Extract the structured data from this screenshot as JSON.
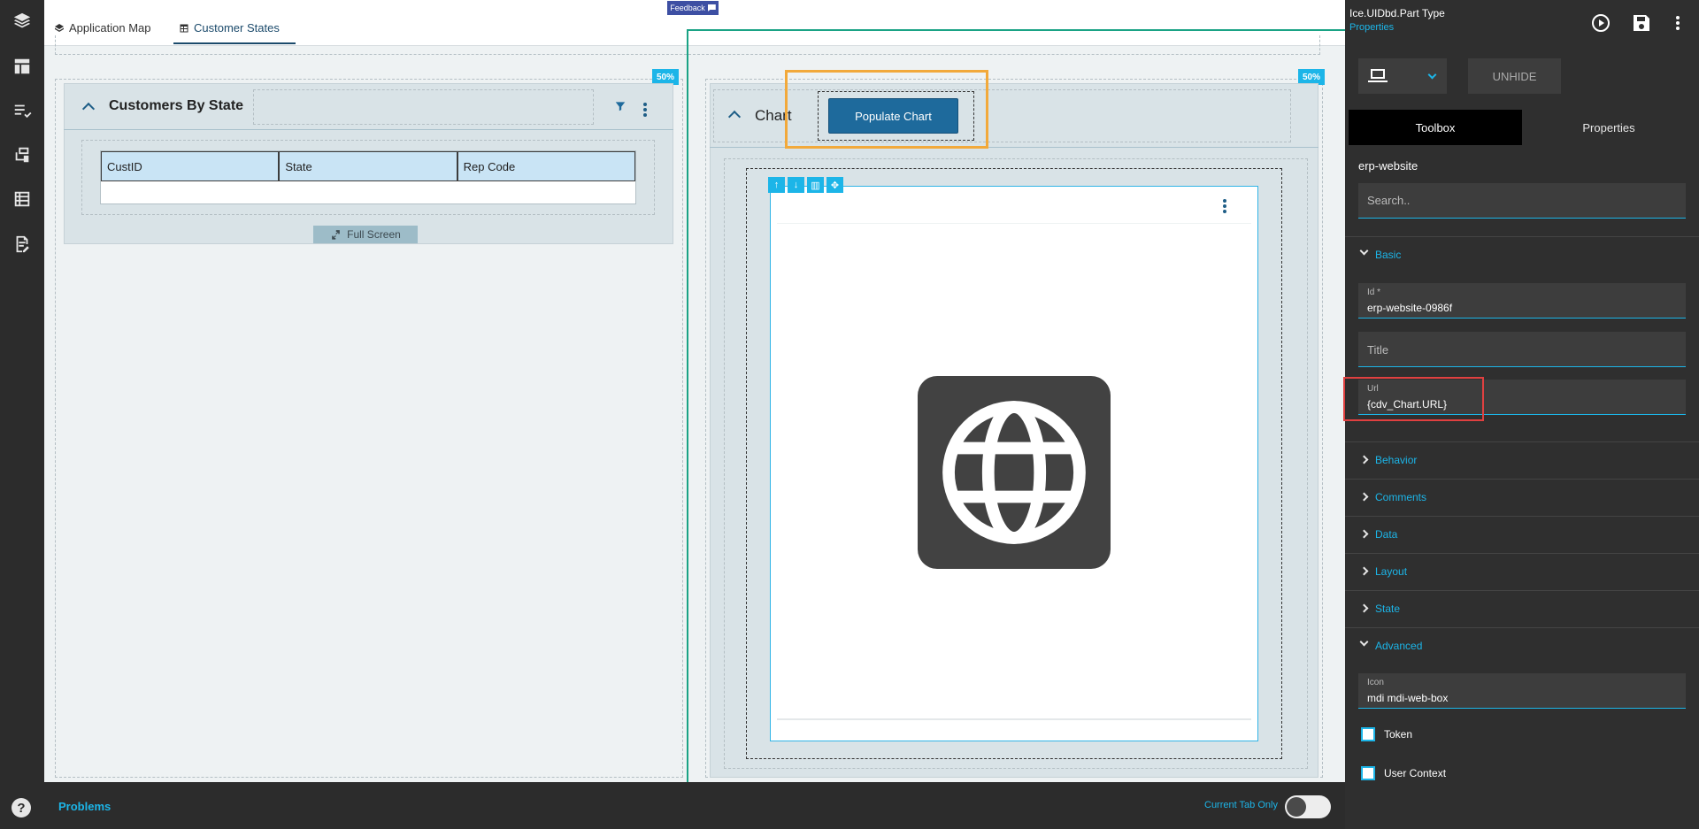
{
  "tabs": [
    {
      "label": "Application Map",
      "active": false
    },
    {
      "label": "Customer States",
      "active": true
    }
  ],
  "feedback_label": "Feedback",
  "layout_badges": [
    "50%",
    "50%"
  ],
  "customers_panel": {
    "title": "Customers By State",
    "columns": [
      "CustID",
      "State",
      "Rep Code"
    ],
    "full_screen_label": "Full Screen"
  },
  "chart_panel": {
    "title": "Chart",
    "populate_label": "Populate Chart",
    "web_icon": "globe-icon"
  },
  "bottom": {
    "problems_label": "Problems",
    "current_tab_label": "Current Tab Only",
    "toggle_on": false
  },
  "props": {
    "title": "Ice.UIDbd.Part Type",
    "subtitle": "Properties",
    "unhide_label": "UNHIDE",
    "tabs": [
      "Toolbox",
      "Properties"
    ],
    "component_name": "erp-website",
    "search_placeholder": "Search..",
    "sections": {
      "basic": "Basic",
      "behavior": "Behavior",
      "comments": "Comments",
      "data": "Data",
      "layout": "Layout",
      "state": "State",
      "advanced": "Advanced"
    },
    "fields": {
      "id_label": "Id *",
      "id_value": "erp-website-0986f",
      "title_placeholder": "Title",
      "url_label": "Url",
      "url_value": "{cdv_Chart.URL}",
      "icon_label": "Icon",
      "icon_value": "mdi mdi-web-box"
    },
    "checkboxes": {
      "token_label": "Token",
      "user_context_label": "User Context"
    }
  },
  "colors": {
    "accent": "#1cb5e8",
    "primary_button": "#1e6a9c",
    "highlight_orange": "#f2a93b",
    "highlight_green": "#1aa385",
    "highlight_red": "#e04040"
  }
}
